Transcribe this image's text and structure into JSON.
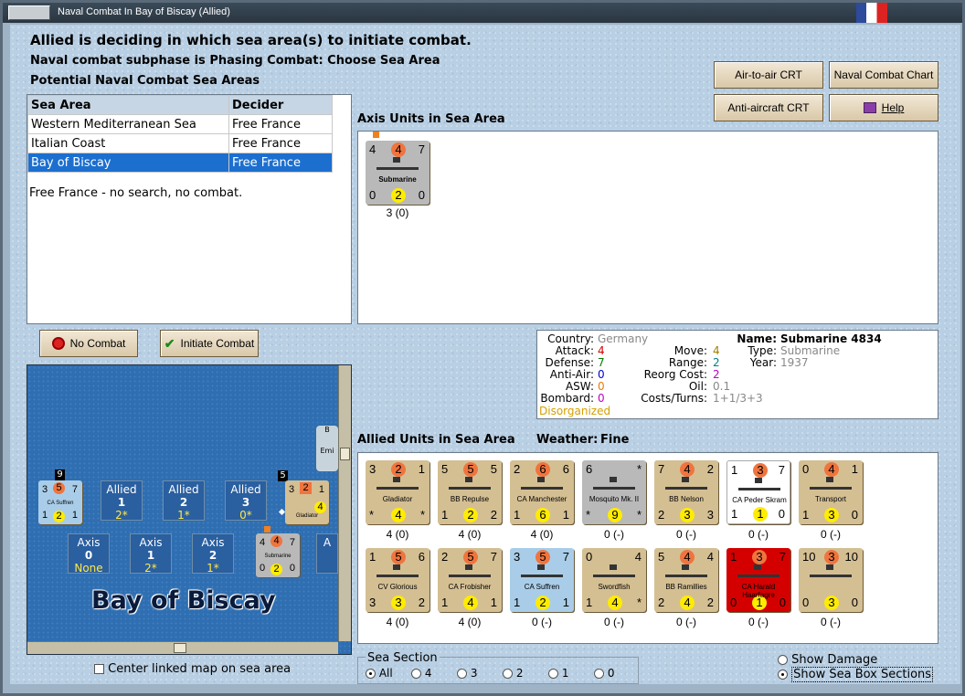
{
  "window": {
    "title": "Naval Combat In Bay of Biscay (Allied)"
  },
  "header": {
    "line1": "Allied is deciding in which sea area(s) to initiate combat.",
    "line2": "Naval combat subphase is Phasing Combat: Choose Sea Area",
    "line3": "Potential Naval Combat Sea Areas"
  },
  "buttons": {
    "air_to_air": "Air-to-air CRT",
    "naval_chart": "Naval Combat Chart",
    "anti_aircraft": "Anti-aircraft CRT",
    "help": "Help",
    "no_combat": "No Combat",
    "initiate_combat": "Initiate Combat"
  },
  "sea_table": {
    "columns": [
      "Sea Area",
      "Decider"
    ],
    "rows": [
      [
        "Western Mediterranean Sea",
        "Free France"
      ],
      [
        "Italian Coast",
        "Free France"
      ],
      [
        "Bay of Biscay",
        "Free France"
      ]
    ],
    "note": "Free France - no search, no combat."
  },
  "axis_units": {
    "title": "Axis Units in Sea Area",
    "counters": [
      {
        "tl": "4",
        "tc": "4",
        "tr": "7",
        "name": "Submarine",
        "bl": "0",
        "bc": "2",
        "br": "0",
        "caption": "3 (0)"
      }
    ]
  },
  "info": {
    "country_label": "Country:",
    "country": "Germany",
    "attack_label": "Attack:",
    "attack": "4",
    "defense_label": "Defense:",
    "defense": "7",
    "antiair_label": "Anti-Air:",
    "antiair": "0",
    "asw_label": "ASW:",
    "asw": "0",
    "bombard_label": "Bombard:",
    "bombard": "0",
    "status": "Disorganized",
    "move_label": "Move:",
    "move": "4",
    "range_label": "Range:",
    "range": "2",
    "reorg_label": "Reorg Cost:",
    "reorg": "2",
    "oil_label": "Oil:",
    "oil": "0.1",
    "costs_label": "Costs/Turns:",
    "costs": "1+1/3+3",
    "name_label": "Name:",
    "name": "Submarine 4834",
    "type_label": "Type:",
    "type": "Submarine",
    "year_label": "Year:",
    "year": "1937"
  },
  "allied_units": {
    "title": "Allied Units in Sea Area",
    "weather_label": "Weather:",
    "weather": "Fine",
    "row1": [
      {
        "tl": "3",
        "tc": "2",
        "tr": "1",
        "name": "Gladiator",
        "bl": "*",
        "bc": "4",
        "br": "*",
        "caption": "4 (0)"
      },
      {
        "tl": "5",
        "tc": "5",
        "tr": "5",
        "name": "BB Repulse",
        "bl": "1",
        "bc": "2",
        "br": "2",
        "caption": "4 (0)"
      },
      {
        "tl": "2",
        "tc": "6",
        "tr": "6",
        "name": "CA Manchester",
        "bl": "1",
        "bc": "6",
        "br": "1",
        "caption": "4 (0)"
      },
      {
        "tl": "6",
        "tc": "",
        "tr": "*",
        "name": "Mosquito Mk. II",
        "bl": "*",
        "bc": "9",
        "br": "*",
        "caption": "0 (-)"
      },
      {
        "tl": "7",
        "tc": "4",
        "tr": "2",
        "name": "BB Nelson",
        "bl": "2",
        "bc": "3",
        "br": "3",
        "caption": "0 (-)"
      },
      {
        "tl": "1",
        "tc": "3",
        "tr": "7",
        "name": "CA Peder Skram",
        "bl": "1",
        "bc": "1",
        "br": "0",
        "caption": "0 (-)"
      },
      {
        "tl": "0",
        "tc": "4",
        "tr": "1",
        "name": "Transport",
        "bl": "1",
        "bc": "3",
        "br": "0",
        "caption": "0 (-)"
      }
    ],
    "row2": [
      {
        "tl": "1",
        "tc": "5",
        "tr": "6",
        "name": "CV Glorious",
        "bl": "3",
        "bc": "3",
        "br": "2",
        "caption": "4 (0)"
      },
      {
        "tl": "2",
        "tc": "5",
        "tr": "7",
        "name": "CA Frobisher",
        "bl": "1",
        "bc": "4",
        "br": "1",
        "caption": "4 (0)"
      },
      {
        "tl": "3",
        "tc": "5",
        "tr": "7",
        "name": "CA Suffren",
        "bl": "1",
        "bc": "2",
        "br": "1",
        "caption": "0 (-)"
      },
      {
        "tl": "0",
        "tc": "",
        "tr": "4",
        "name": "Swordfish",
        "bl": "1",
        "bc": "4",
        "br": "*",
        "caption": "0 (-)"
      },
      {
        "tl": "5",
        "tc": "4",
        "tr": "4",
        "name": "BB Ramillies",
        "bl": "2",
        "bc": "4",
        "br": "2",
        "caption": "0 (-)"
      },
      {
        "tl": "1",
        "tc": "3",
        "tr": "7",
        "name": "CA Harald Haarfagre",
        "bl": "0",
        "bc": "1",
        "br": "0",
        "caption": "0 (-)"
      },
      {
        "tl": "10",
        "tc": "3",
        "tr": "10",
        "name": "",
        "bl": "0",
        "bc": "3",
        "br": "0",
        "caption": "0 (-)"
      }
    ]
  },
  "map": {
    "sea_name": "Bay of Biscay",
    "allied_boxes": [
      {
        "label": "Allied",
        "num": "1",
        "val": "2*"
      },
      {
        "label": "Allied",
        "num": "2",
        "val": "1*"
      },
      {
        "label": "Allied",
        "num": "3",
        "val": "0*"
      }
    ],
    "axis_boxes": [
      {
        "label": "Axis",
        "num": "0",
        "val": "None"
      },
      {
        "label": "Axis",
        "num": "1",
        "val": "2*"
      },
      {
        "label": "Axis",
        "num": "2",
        "val": "1*"
      },
      {
        "label": "A",
        "num": "",
        "val": ""
      }
    ],
    "stack_count_a": "9",
    "stack_count_b": "5",
    "counter_suffren": {
      "tl": "3",
      "tc": "5",
      "tr": "7",
      "name": "CA Suffren",
      "bl": "1",
      "bc": "2",
      "br": "1"
    },
    "counter_gladiator": {
      "tl": "3",
      "tc": "2",
      "tr": "1",
      "name": "Gladiator",
      "bc": "4"
    },
    "counter_sub": {
      "tl": "4",
      "tc": "4",
      "tr": "7",
      "name": "Submarine",
      "bl": "0",
      "bc": "2",
      "br": "0"
    },
    "partial_label_1": "B",
    "partial_label_2": "Emi"
  },
  "options": {
    "center_map": "Center linked map on sea area",
    "sea_section_label": "Sea Section",
    "sections": [
      "All",
      "4",
      "3",
      "2",
      "1",
      "0"
    ],
    "show_damage": "Show Damage",
    "show_boxes": "Show Sea Box Sections"
  },
  "colors": {
    "attack": "#d40000",
    "defense": "#008000",
    "antiair": "#0000cc",
    "asw": "#e87a00",
    "bombard": "#c000c0",
    "status": "#d4a000",
    "move": "#a08000",
    "range": "#008080",
    "reorg": "#c000c0",
    "gray": "#888888"
  }
}
